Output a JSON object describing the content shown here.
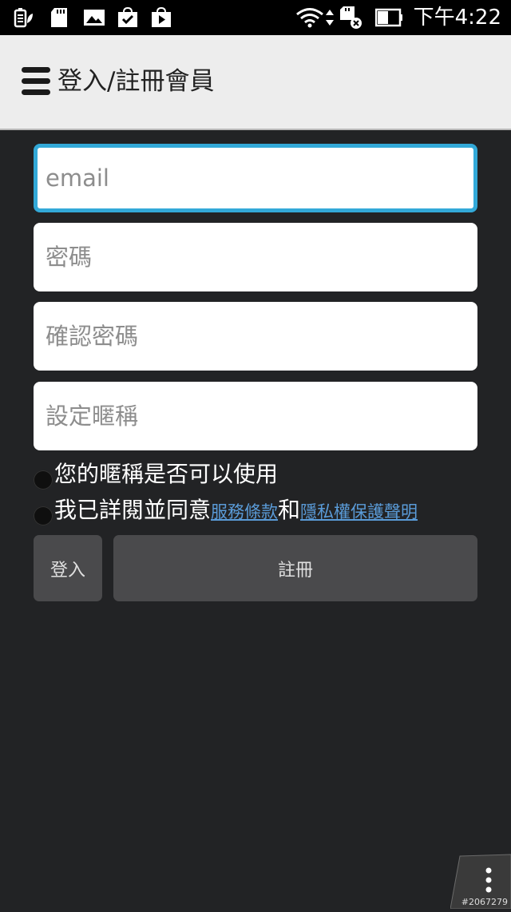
{
  "status_bar": {
    "time": "下午4:22",
    "icons": [
      "battery-saver-icon",
      "sd-card-icon",
      "image-icon",
      "check-bag-icon",
      "play-store-icon",
      "wifi-icon",
      "sd-card-error-icon",
      "battery-icon"
    ]
  },
  "action_bar": {
    "title": "登入/註冊會員",
    "menu_icon": "hamburger-menu-icon"
  },
  "form": {
    "email_placeholder": "email",
    "password_placeholder": "密碼",
    "confirm_password_placeholder": "確認密碼",
    "nickname_placeholder": "設定暱稱",
    "nickname_check_label": "您的暱稱是否可以使用",
    "agree_label": "我已詳閱並同意",
    "terms_link": "服務條款",
    "and_text": "和",
    "privacy_link": "隱私權保護聲明"
  },
  "buttons": {
    "login_label": "登入",
    "register_label": "註冊"
  },
  "watermark": "#2067279",
  "colors": {
    "background": "#222325",
    "action_bar": "#ededed",
    "focus_border": "#33a9d8",
    "link": "#5a9bd8",
    "button": "#4a4a4c"
  }
}
